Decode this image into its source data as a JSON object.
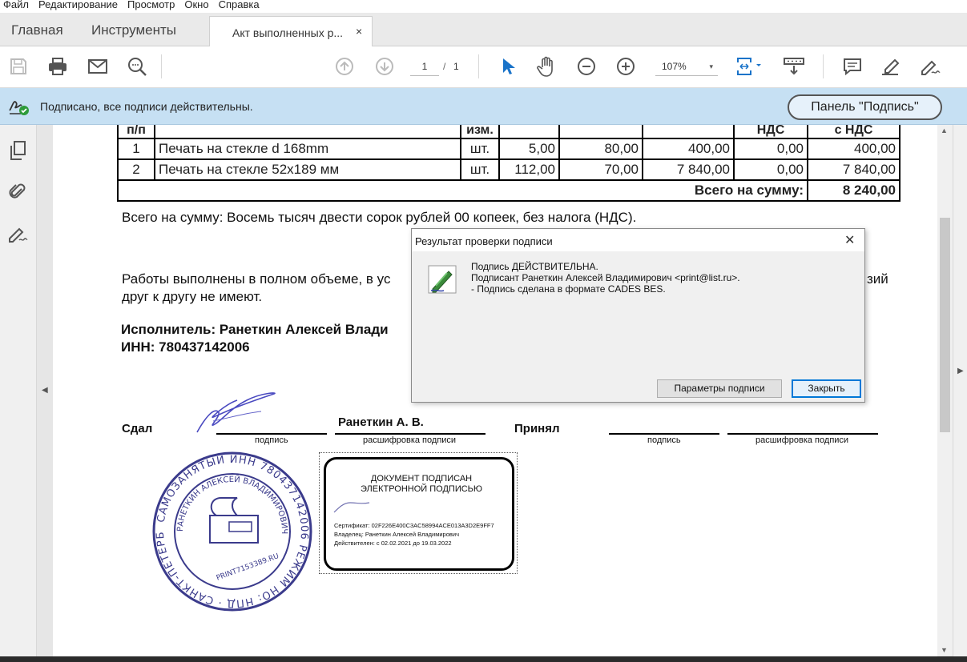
{
  "menu": [
    "Файл",
    "Редактирование",
    "Просмотр",
    "Окно",
    "Справка"
  ],
  "tabs": {
    "home": "Главная",
    "tools": "Инструменты",
    "document": "Акт выполненных р...",
    "close": "×"
  },
  "toolbar": {
    "page_current": "1",
    "page_sep": "/",
    "page_total": "1",
    "zoom": "107%",
    "zoom_arrow": "▾",
    "icons": [
      "save-icon",
      "print-icon",
      "email-icon",
      "search-icon",
      "page-up-icon",
      "page-down-icon",
      "select-arrow-icon",
      "hand-icon",
      "zoom-out-icon",
      "zoom-in-icon",
      "fit-page-icon",
      "scroll-mode-icon",
      "comment-icon",
      "highlight-icon",
      "sign-icon"
    ]
  },
  "signature_bar": {
    "message": "Подписано, все подписи действительны.",
    "panel_button": "Панель \"Подпись\""
  },
  "document": {
    "table": {
      "header": [
        "п/п",
        "",
        "изм.",
        "",
        "",
        "",
        "НДС",
        "с НДС"
      ],
      "rows": [
        [
          "1",
          "Печать на стекле d 168mm",
          "шт.",
          "5,00",
          "80,00",
          "400,00",
          "0,00",
          "400,00"
        ],
        [
          "2",
          "Печать на стекле 52x189 мм",
          "шт.",
          "112,00",
          "70,00",
          "7 840,00",
          "0,00",
          "7 840,00"
        ]
      ],
      "total_label": "Всего на сумму:",
      "total_value": "8 240,00"
    },
    "total_words": "Всего на сумму: Восемь тысяч двести сорок рублей 00 копеек, без налога (НДС).",
    "works_line1a": "Работы выполнены в полном объеме, в ус",
    "works_line1b": "зий",
    "works_line2": "друг к другу не имеют.",
    "executor": "Исполнитель: Ранеткин Алексей Влади",
    "inn": "ИНН: 780437142006",
    "handed": "Сдал",
    "handed_name": "Ранеткин А. В.",
    "accepted": "Принял",
    "sig_caption": "подпись",
    "decode_caption": "расшифровка подписи",
    "stamp": {
      "outer_text": "САМОЗАНЯТЫЙ ИНН 780437142006 РЕЖИМ НО: НПД",
      "inner_text": "РАНЕТКИН АЛЕКСЕЙ ВЛАДИМИРОВИЧ",
      "bottom_text": "САНКТ-ПЕТЕРБУРГ",
      "site": "PRINT7153389.RU"
    },
    "esign": {
      "title1": "ДОКУМЕНТ ПОДПИСАН",
      "title2": "ЭЛЕКТРОННОЙ ПОДПИСЬЮ",
      "cert": "Сертификат: 02F226E400C3AC58994ACE013A3D2E9FF7",
      "owner": "Владелец: Ранеткин Алексей Владимирович",
      "valid": "Действителен: с 02.02.2021 до 19.03.2022"
    }
  },
  "dialog": {
    "title": "Результат проверки подписи",
    "close": "✕",
    "line1": "Подпись ДЕЙСТВИТЕЛЬНА.",
    "line2": "Подписант Ранеткин Алексей Владимирович <print@list.ru>.",
    "line3": "- Подпись сделана в формате CADES BES.",
    "btn_params": "Параметры подписи",
    "btn_close": "Закрыть"
  },
  "colors": {
    "signature_bar": "#c6e0f3",
    "accent": "#0078d7",
    "select_tool": "#1a73c9"
  }
}
